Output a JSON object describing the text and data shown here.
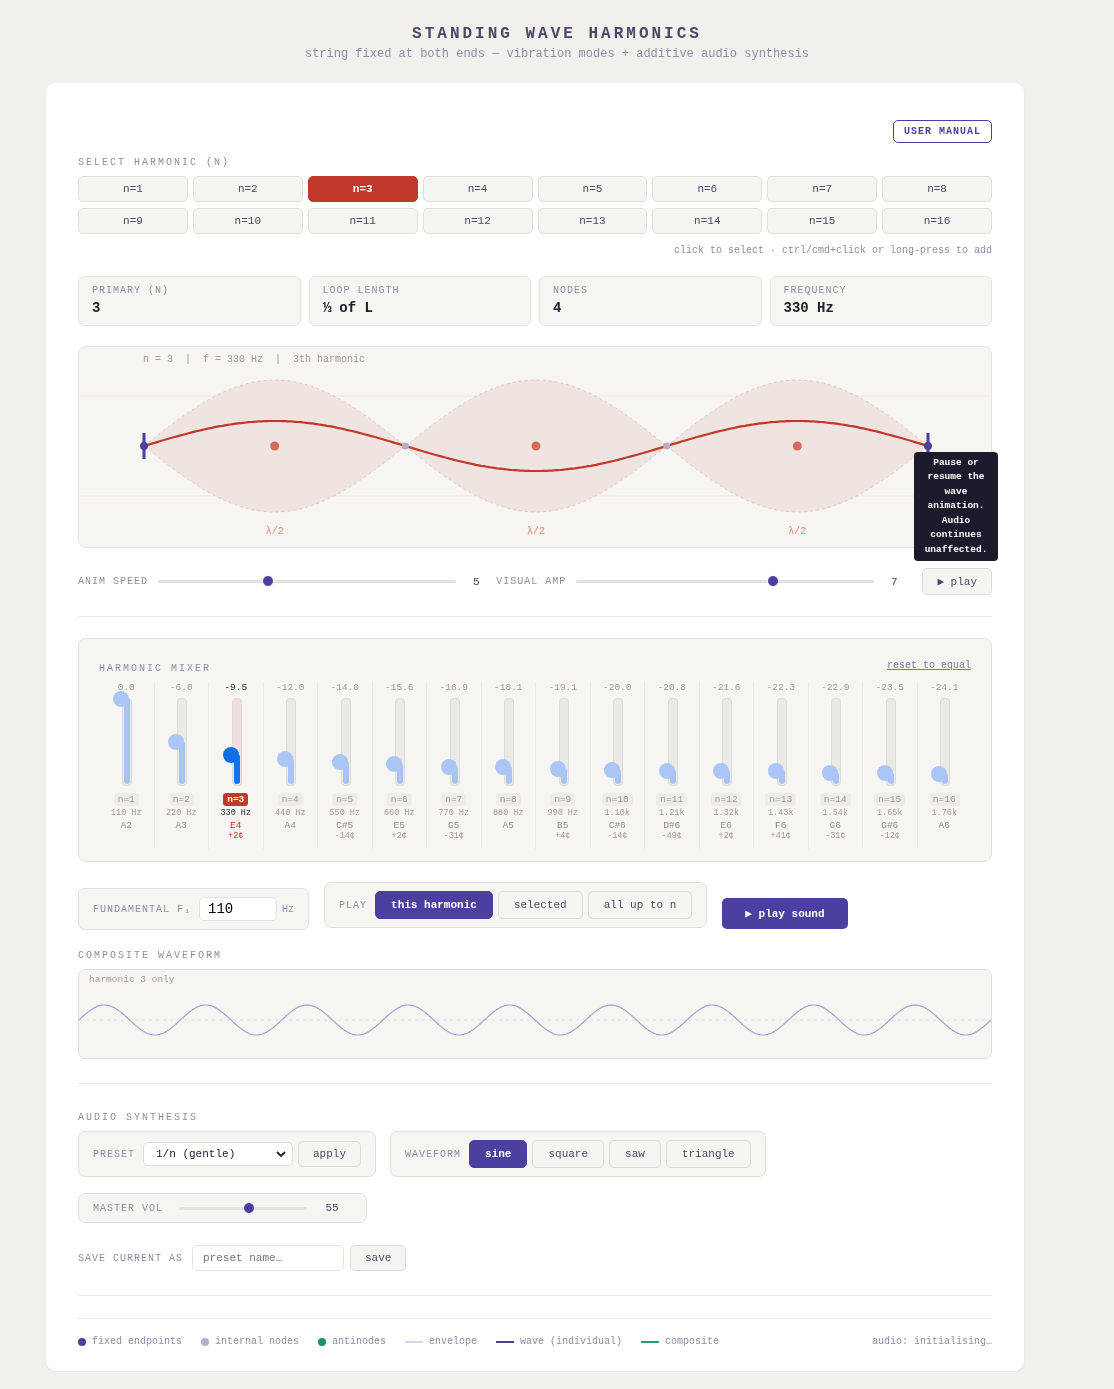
{
  "header": {
    "title": "STANDING WAVE HARMONICS",
    "subtitle": "string fixed at both ends — vibration modes + additive audio synthesis"
  },
  "manual_button": "USER MANUAL",
  "harmonic_select": {
    "label": "SELECT HARMONIC (N)",
    "hint": "click to select · ctrl/cmd+click or long-press to add",
    "buttons": [
      {
        "label": "n=1",
        "selected": false
      },
      {
        "label": "n=2",
        "selected": false
      },
      {
        "label": "n=3",
        "selected": true
      },
      {
        "label": "n=4",
        "selected": false
      },
      {
        "label": "n=5",
        "selected": false
      },
      {
        "label": "n=6",
        "selected": false
      },
      {
        "label": "n=7",
        "selected": false
      },
      {
        "label": "n=8",
        "selected": false
      },
      {
        "label": "n=9",
        "selected": false
      },
      {
        "label": "n=10",
        "selected": false
      },
      {
        "label": "n=11",
        "selected": false
      },
      {
        "label": "n=12",
        "selected": false
      },
      {
        "label": "n=13",
        "selected": false
      },
      {
        "label": "n=14",
        "selected": false
      },
      {
        "label": "n=15",
        "selected": false
      },
      {
        "label": "n=16",
        "selected": false
      }
    ]
  },
  "stats": [
    {
      "label": "PRIMARY (N)",
      "value": "3"
    },
    {
      "label": "LOOP LENGTH",
      "value": "⅓ of L"
    },
    {
      "label": "NODES",
      "value": "4"
    },
    {
      "label": "FREQUENCY",
      "value": "330 Hz"
    }
  ],
  "diagram": {
    "info": "n = 3  |  f = 330 Hz  |  3th harmonic",
    "loop_labels": [
      "λ/2",
      "λ/2",
      "λ/2"
    ]
  },
  "controls": {
    "sliders": [
      {
        "label": "ANIM SPEED",
        "level": 0.37,
        "reading": "5"
      },
      {
        "label": "VISUAL AMP",
        "level": 0.66,
        "reading": "7"
      }
    ],
    "play_button": "▶ play",
    "tooltip": "Pause or resume the wave animation. Audio continues unaffected."
  },
  "mixer": {
    "title": "HARMONIC MIXER",
    "reset_link": "reset to equal",
    "channels": [
      {
        "db": "0.0",
        "label": "n=1",
        "freq": "110 Hz",
        "note": "A2",
        "level": 1.0,
        "selected": false
      },
      {
        "db": "-6.0",
        "label": "n=2",
        "freq": "220 Hz",
        "note": "A3",
        "level": 0.5,
        "selected": false
      },
      {
        "db": "-9.5",
        "label": "n=3",
        "freq": "330 Hz",
        "note": "E4",
        "cents": "+2¢",
        "level": 0.35,
        "selected": true
      },
      {
        "db": "-12.0",
        "label": "n=4",
        "freq": "440 Hz",
        "note": "A4",
        "level": 0.3,
        "selected": false
      },
      {
        "db": "-14.0",
        "label": "n=5",
        "freq": "550 Hz",
        "note": "C#5",
        "cents": "-14¢",
        "level": 0.27,
        "selected": false
      },
      {
        "db": "-15.6",
        "label": "n=6",
        "freq": "660 Hz",
        "note": "E5",
        "cents": "+2¢",
        "level": 0.24,
        "selected": false
      },
      {
        "db": "-16.9",
        "label": "n=7",
        "freq": "770 Hz",
        "note": "G5",
        "cents": "-31¢",
        "level": 0.21,
        "selected": false
      },
      {
        "db": "-18.1",
        "label": "n=8",
        "freq": "880 Hz",
        "note": "A5",
        "level": 0.21,
        "selected": false
      },
      {
        "db": "-19.1",
        "label": "n=9",
        "freq": "990 Hz",
        "note": "B5",
        "cents": "+4¢",
        "level": 0.19,
        "selected": false
      },
      {
        "db": "-20.0",
        "label": "n=10",
        "freq": "1.10k",
        "note": "C#6",
        "cents": "-14¢",
        "level": 0.17,
        "selected": false
      },
      {
        "db": "-20.8",
        "label": "n=11",
        "freq": "1.21k",
        "note": "D#6",
        "cents": "-49¢",
        "level": 0.16,
        "selected": false
      },
      {
        "db": "-21.6",
        "label": "n=12",
        "freq": "1.32k",
        "note": "E6",
        "cents": "+2¢",
        "level": 0.16,
        "selected": false
      },
      {
        "db": "-22.3",
        "label": "n=13",
        "freq": "1.43k",
        "note": "F6",
        "cents": "+41¢",
        "level": 0.16,
        "selected": false
      },
      {
        "db": "-22.9",
        "label": "n=14",
        "freq": "1.54k",
        "note": "G6",
        "cents": "-31¢",
        "level": 0.14,
        "selected": false
      },
      {
        "db": "-23.5",
        "label": "n=15",
        "freq": "1.65k",
        "note": "G#6",
        "cents": "-12¢",
        "level": 0.14,
        "selected": false
      },
      {
        "db": "-24.1",
        "label": "n=16",
        "freq": "1.76k",
        "note": "A6",
        "level": 0.13,
        "selected": false
      }
    ]
  },
  "fundamental": {
    "label": "FUNDAMENTAL F₁",
    "value": "110",
    "unit": "Hz"
  },
  "play_mode": {
    "label": "PLAY",
    "options": [
      {
        "label": "this harmonic",
        "selected": true
      },
      {
        "label": "selected",
        "selected": false
      },
      {
        "label": "all up to n",
        "selected": false
      }
    ]
  },
  "play_sound_button": "▶ play sound",
  "composite": {
    "title": "COMPOSITE WAVEFORM",
    "caption": "harmonic 3 only"
  },
  "audio_synthesis": {
    "title": "AUDIO SYNTHESIS",
    "preset": {
      "label": "PRESET",
      "value": "1/n (gentle)",
      "button": "apply"
    },
    "waveform": {
      "label": "WAVEFORM",
      "options": [
        {
          "label": "sine",
          "selected": true
        },
        {
          "label": "square",
          "selected": false
        },
        {
          "label": "saw",
          "selected": false
        },
        {
          "label": "triangle",
          "selected": false
        }
      ]
    },
    "master_volume": {
      "label": "MASTER VOL",
      "level": 0.55,
      "reading": "55"
    },
    "save": {
      "label": "SAVE CURRENT AS",
      "placeholder": "preset name…",
      "button": "save"
    }
  },
  "legend": [
    {
      "kind": "dot",
      "label": "fixed endpoints",
      "color": "#4b3fa0"
    },
    {
      "kind": "dot",
      "label": "internal nodes",
      "color": "#b2aec6"
    },
    {
      "kind": "dot",
      "label": "antinodes",
      "color": "#1b8f6a"
    },
    {
      "kind": "line",
      "label": "envelope",
      "color": "#d8d5ea"
    },
    {
      "kind": "line",
      "label": "wave (individual)",
      "color": "#4b3fa0"
    },
    {
      "kind": "line",
      "label": "composite",
      "color": "#1f9e70"
    }
  ],
  "status": "audio: initialising…"
}
